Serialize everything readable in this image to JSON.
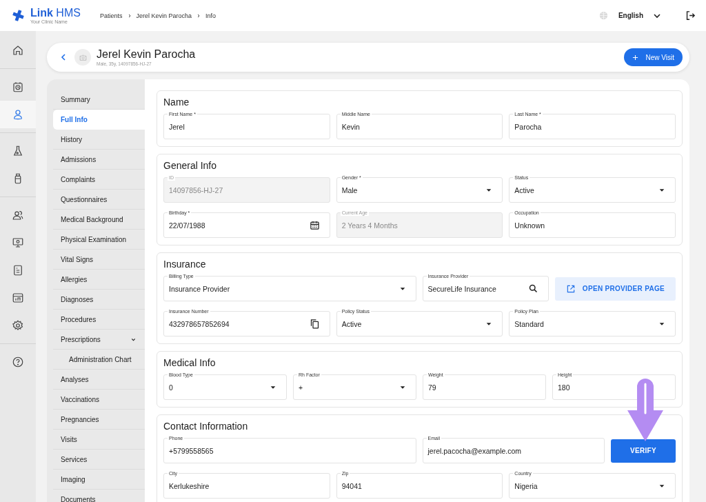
{
  "app": {
    "logo": "**Link** HMS",
    "clinic": "Your Clinic Name"
  },
  "breadcrumb": [
    "Patients",
    "Jerel Kevin Parocha",
    "Info"
  ],
  "language": "English",
  "rail": [
    {
      "selected": false
    },
    {
      "selected": false
    },
    {
      "selected": true
    },
    {
      "selected": false
    },
    {
      "selected": false
    },
    {
      "selected": false
    },
    {
      "selected": false
    },
    {
      "selected": false
    },
    {
      "selected": false
    },
    {
      "selected": false
    },
    {
      "selected": false
    }
  ],
  "patient": {
    "name": "Jerel Kevin Parocha",
    "subtitle": "Male, 35y, 14097856-HJ-27",
    "action": "New Visit"
  },
  "nav": [
    {
      "label": "Summary",
      "selected": false
    },
    {
      "label": "Full Info",
      "selected": true
    },
    {
      "label": "History",
      "selected": false
    },
    {
      "label": "Admissions",
      "selected": false
    },
    {
      "label": "Complaints",
      "selected": false
    },
    {
      "label": "Questionnaires",
      "selected": false
    },
    {
      "label": "Medical Background",
      "selected": false
    },
    {
      "label": "Physical Examination",
      "selected": false
    },
    {
      "label": "Vital Signs",
      "selected": false
    },
    {
      "label": "Allergies",
      "selected": false
    },
    {
      "label": "Diagnoses",
      "selected": false
    },
    {
      "label": "Procedures",
      "selected": false
    },
    {
      "label": "Prescriptions",
      "selected": false,
      "expanded": true,
      "children": [
        {
          "label": "Administration Chart",
          "selected": false
        }
      ]
    },
    {
      "label": "Analyses",
      "selected": false
    },
    {
      "label": "Vaccinations",
      "selected": false
    },
    {
      "label": "Pregnancies",
      "selected": false
    },
    {
      "label": "Visits",
      "selected": false
    },
    {
      "label": "Services",
      "selected": false
    },
    {
      "label": "Imaging",
      "selected": false
    },
    {
      "label": "Documents",
      "selected": false
    }
  ],
  "sections": [
    {
      "title": "Name",
      "rows": [
        [
          {
            "kind": "text",
            "label": "First Name *",
            "value": "Jerel",
            "disabled": false
          },
          {
            "kind": "text",
            "label": "Middle Name",
            "value": "Kevin",
            "disabled": false
          },
          {
            "kind": "text",
            "label": "Last Name *",
            "value": "Parocha",
            "disabled": false
          }
        ]
      ]
    },
    {
      "title": "General Info",
      "rows": [
        [
          {
            "kind": "text",
            "label": "ID",
            "value": "14097856-HJ-27",
            "disabled": true
          },
          {
            "kind": "select",
            "label": "Gender *",
            "value": "Male",
            "disabled": false
          },
          {
            "kind": "select",
            "label": "Status",
            "value": "Active",
            "disabled": false
          }
        ],
        [
          {
            "kind": "date",
            "label": "Birthday *",
            "value": "22/07/1988",
            "disabled": false
          },
          {
            "kind": "text",
            "label": "Current Age",
            "value": "2 Years 4 Months",
            "disabled": true
          },
          {
            "kind": "text",
            "label": "Occupation",
            "value": "Unknown",
            "disabled": false
          }
        ]
      ]
    },
    {
      "title": "Insurance",
      "rows": [
        [
          {
            "kind": "select",
            "label": "Billing Type",
            "value": "Insurance Provider",
            "disabled": false
          },
          {
            "kind": "search",
            "label": "Insurance Provider",
            "value": "SecureLife Insurance",
            "disabled": false
          },
          {
            "kind": "link-button",
            "label": "OPEN PROVIDER PAGE",
            "disabled": false
          }
        ],
        [
          {
            "kind": "copy",
            "label": "Insurance Number",
            "value": "432978657852694",
            "disabled": false
          },
          {
            "kind": "select",
            "label": "Policy Status",
            "value": "Active",
            "disabled": false
          },
          {
            "kind": "select",
            "label": "Policy Plan",
            "value": "Standard",
            "disabled": false
          }
        ]
      ]
    },
    {
      "title": "Medical Info",
      "rows": [
        [
          {
            "kind": "select",
            "label": "Blood Type",
            "value": "0",
            "disabled": false
          },
          {
            "kind": "select",
            "label": "Rh Factor",
            "value": "+",
            "disabled": false
          },
          {
            "kind": "text",
            "label": "Weight",
            "value": "79",
            "disabled": false
          },
          {
            "kind": "text",
            "label": "Height",
            "value": "180",
            "disabled": false
          }
        ]
      ]
    },
    {
      "title": "Contact Information",
      "rows": [
        [
          {
            "kind": "text",
            "label": "Phone",
            "value": "+5799558565",
            "disabled": false
          },
          {
            "kind": "text",
            "label": "Email",
            "value": "jerel.pacocha@example.com",
            "disabled": false
          },
          {
            "kind": "button",
            "label": "VERIFY",
            "disabled": false
          }
        ],
        [
          {
            "kind": "text",
            "label": "City",
            "value": "Kerlukeshire",
            "disabled": false
          },
          {
            "kind": "text",
            "label": "Zip",
            "value": "94041",
            "disabled": false
          },
          {
            "kind": "select",
            "label": "Country",
            "value": "Nigeria",
            "disabled": false
          }
        ]
      ]
    }
  ]
}
